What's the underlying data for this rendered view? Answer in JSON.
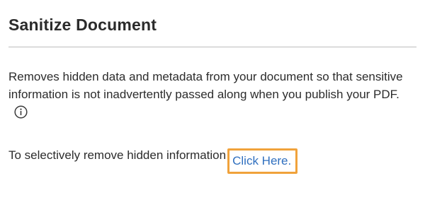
{
  "panel": {
    "title": "Sanitize Document",
    "description": "Removes hidden data and metadata from your document so that sensitive information is not inadvertently passed along when you publish your PDF.",
    "info_icon": "info-circle-icon",
    "remove_text": "To selectively remove hidden information",
    "link_label": "Click Here.",
    "colors": {
      "link": "#2f6fbf",
      "highlight_border": "#f0a23b",
      "divider": "#bdbdbd",
      "title_text": "#2b2b2b"
    }
  }
}
